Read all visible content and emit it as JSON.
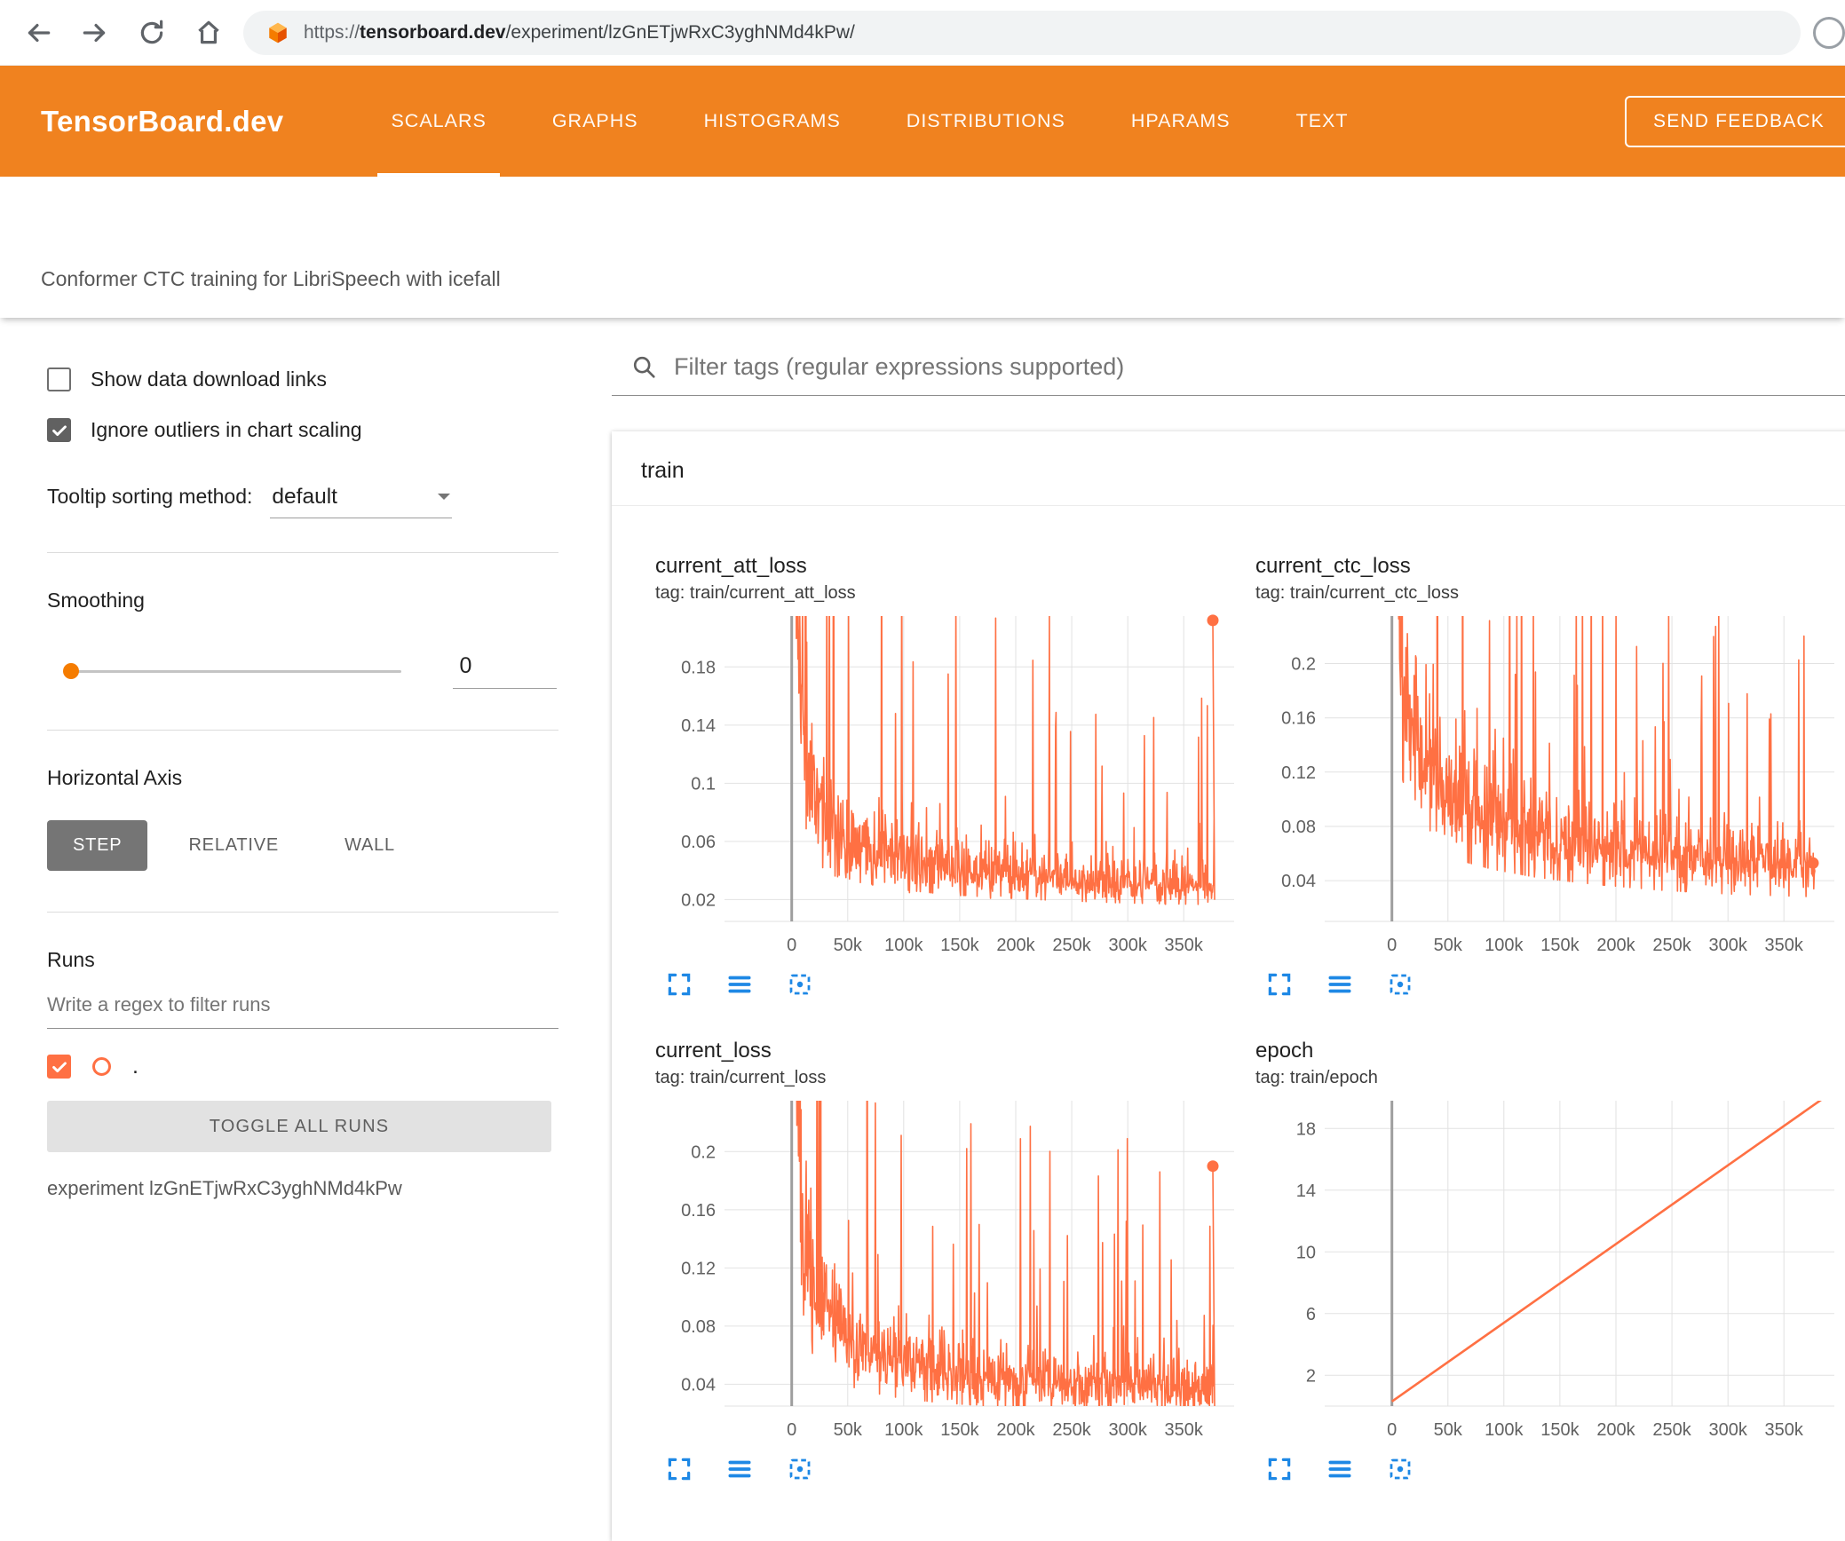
{
  "browser": {
    "url_scheme": "https://",
    "url_host": "tensorboard.dev",
    "url_path": "/experiment/lzGnETjwRxC3yghNMd4kPw/"
  },
  "header": {
    "logo": "TensorBoard.dev",
    "tabs": [
      {
        "label": "SCALARS",
        "active": true
      },
      {
        "label": "GRAPHS",
        "active": false
      },
      {
        "label": "HISTOGRAMS",
        "active": false
      },
      {
        "label": "DISTRIBUTIONS",
        "active": false
      },
      {
        "label": "HPARAMS",
        "active": false
      },
      {
        "label": "TEXT",
        "active": false
      }
    ],
    "feedback_button": "SEND FEEDBACK"
  },
  "subtitle": "Conformer CTC training for LibriSpeech with icefall",
  "sidebar": {
    "show_download": {
      "label": "Show data download links",
      "checked": false
    },
    "ignore_outliers": {
      "label": "Ignore outliers in chart scaling",
      "checked": true
    },
    "tooltip_sorting": {
      "label": "Tooltip sorting method:",
      "value": "default"
    },
    "smoothing": {
      "label": "Smoothing",
      "value": "0"
    },
    "horizontal_axis": {
      "label": "Horizontal Axis",
      "options": [
        "STEP",
        "RELATIVE",
        "WALL"
      ],
      "selected": "STEP"
    },
    "runs": {
      "label": "Runs",
      "filter_placeholder": "Write a regex to filter runs",
      "run_label": ".",
      "run_checked": true,
      "toggle_button": "TOGGLE ALL RUNS",
      "experiment": "experiment lzGnETjwRxC3yghNMd4kPw"
    }
  },
  "main": {
    "filter_placeholder": "Filter tags (regular expressions supported)",
    "section": "train",
    "chart_toolbar_icons": [
      "fullscreen-icon",
      "run-lines-icon",
      "fit-domain-icon"
    ]
  },
  "colors": {
    "appbar_orange": "#f0821f",
    "run_orange": "#ff7043",
    "toolbar_icon_blue": "#1e88e5",
    "grid_light": "#e2e2e2",
    "axis_dark": "#9e9e9e",
    "tick_label": "#616161"
  },
  "chart_data": [
    {
      "type": "line",
      "title": "current_att_loss",
      "tag": "tag: train/current_att_loss",
      "x_tick_labels": [
        "0",
        "50k",
        "100k",
        "150k",
        "200k",
        "250k",
        "300k",
        "350k"
      ],
      "x_tick_values": [
        0,
        50000,
        100000,
        150000,
        200000,
        250000,
        300000,
        350000
      ],
      "xlim": [
        -60000,
        395000
      ],
      "y_tick_labels": [
        "0.02",
        "0.06",
        "0.1",
        "0.14",
        "0.18"
      ],
      "y_tick_values": [
        0.02,
        0.06,
        0.1,
        0.14,
        0.18
      ],
      "ylim": [
        0.005,
        0.215
      ],
      "grid": true,
      "series": [
        {
          "name": ".",
          "color": "#ff7043",
          "style": "noisy",
          "seed": 11,
          "x_range": [
            0,
            378000
          ],
          "n_points": 820,
          "envelope": [
            [
              0,
              0.5
            ],
            [
              3000,
              0.28
            ],
            [
              8000,
              0.16
            ],
            [
              15000,
              0.11
            ],
            [
              25000,
              0.085
            ],
            [
              40000,
              0.068
            ],
            [
              60000,
              0.058
            ],
            [
              90000,
              0.05
            ],
            [
              130000,
              0.044
            ],
            [
              180000,
              0.039
            ],
            [
              240000,
              0.035
            ],
            [
              300000,
              0.032
            ],
            [
              378000,
              0.03
            ]
          ],
          "noise_sigma": 0.42,
          "spike_prob": 0.05,
          "spike_max": 4.5,
          "end_marker": [
            376000,
            0.212
          ]
        }
      ]
    },
    {
      "type": "line",
      "title": "current_ctc_loss",
      "tag": "tag: train/current_ctc_loss",
      "x_tick_labels": [
        "0",
        "50k",
        "100k",
        "150k",
        "200k",
        "250k",
        "300k",
        "350k"
      ],
      "x_tick_values": [
        0,
        50000,
        100000,
        150000,
        200000,
        250000,
        300000,
        350000
      ],
      "xlim": [
        -60000,
        395000
      ],
      "y_tick_labels": [
        "0.04",
        "0.08",
        "0.12",
        "0.16",
        "0.2"
      ],
      "y_tick_values": [
        0.04,
        0.08,
        0.12,
        0.16,
        0.2
      ],
      "ylim": [
        0.01,
        0.235
      ],
      "grid": true,
      "series": [
        {
          "name": ".",
          "color": "#ff7043",
          "style": "noisy",
          "seed": 23,
          "x_range": [
            0,
            378000
          ],
          "n_points": 820,
          "envelope": [
            [
              0,
              0.55
            ],
            [
              3000,
              0.33
            ],
            [
              8000,
              0.22
            ],
            [
              15000,
              0.17
            ],
            [
              25000,
              0.14
            ],
            [
              40000,
              0.115
            ],
            [
              60000,
              0.1
            ],
            [
              90000,
              0.088
            ],
            [
              130000,
              0.077
            ],
            [
              180000,
              0.068
            ],
            [
              240000,
              0.06
            ],
            [
              300000,
              0.055
            ],
            [
              378000,
              0.051
            ]
          ],
          "noise_sigma": 0.35,
          "spike_prob": 0.05,
          "spike_max": 2.6,
          "end_marker": [
            376000,
            0.053
          ]
        }
      ]
    },
    {
      "type": "line",
      "title": "current_loss",
      "tag": "tag: train/current_loss",
      "x_tick_labels": [
        "0",
        "50k",
        "100k",
        "150k",
        "200k",
        "250k",
        "300k",
        "350k"
      ],
      "x_tick_values": [
        0,
        50000,
        100000,
        150000,
        200000,
        250000,
        300000,
        350000
      ],
      "xlim": [
        -60000,
        395000
      ],
      "y_tick_labels": [
        "0.04",
        "0.08",
        "0.12",
        "0.16",
        "0.2"
      ],
      "y_tick_values": [
        0.04,
        0.08,
        0.12,
        0.16,
        0.2
      ],
      "ylim": [
        0.025,
        0.235
      ],
      "grid": true,
      "series": [
        {
          "name": ".",
          "color": "#ff7043",
          "style": "noisy",
          "seed": 37,
          "x_range": [
            0,
            378000
          ],
          "n_points": 820,
          "envelope": [
            [
              0,
              0.55
            ],
            [
              3000,
              0.3
            ],
            [
              8000,
              0.18
            ],
            [
              15000,
              0.12
            ],
            [
              25000,
              0.095
            ],
            [
              40000,
              0.078
            ],
            [
              60000,
              0.066
            ],
            [
              90000,
              0.057
            ],
            [
              130000,
              0.05
            ],
            [
              180000,
              0.045
            ],
            [
              240000,
              0.041
            ],
            [
              300000,
              0.039
            ],
            [
              378000,
              0.037
            ]
          ],
          "noise_sigma": 0.4,
          "spike_prob": 0.05,
          "spike_max": 3.8,
          "end_marker": [
            376000,
            0.19
          ]
        }
      ]
    },
    {
      "type": "line",
      "title": "epoch",
      "tag": "tag: train/epoch",
      "x_tick_labels": [
        "0",
        "50k",
        "100k",
        "150k",
        "200k",
        "250k",
        "300k",
        "350k"
      ],
      "x_tick_values": [
        0,
        50000,
        100000,
        150000,
        200000,
        250000,
        300000,
        350000
      ],
      "xlim": [
        -60000,
        395000
      ],
      "y_tick_labels": [
        "2",
        "6",
        "10",
        "14",
        "18"
      ],
      "y_tick_values": [
        2,
        6,
        10,
        14,
        18
      ],
      "ylim": [
        0,
        19.8
      ],
      "grid": true,
      "series": [
        {
          "name": ".",
          "color": "#ff7043",
          "style": "linear",
          "points": [
            [
              0,
              0.3
            ],
            [
              385000,
              19.95
            ]
          ]
        }
      ]
    }
  ]
}
